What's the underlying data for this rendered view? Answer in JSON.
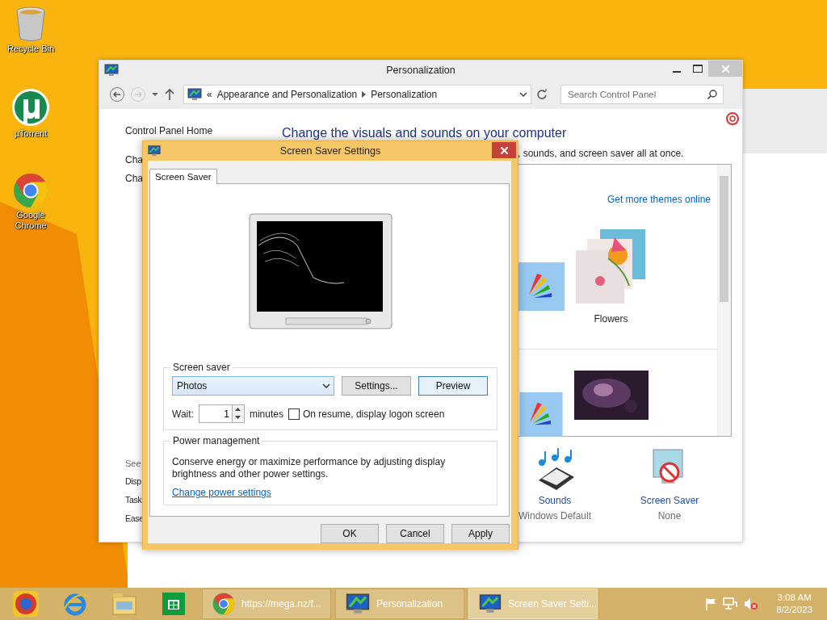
{
  "desktop_icons": [
    {
      "kind": "bin",
      "label": "Recycle Bin"
    },
    {
      "kind": "torrent",
      "label": "µTorrent"
    },
    {
      "kind": "chrome",
      "label": "Google Chrome"
    }
  ],
  "personalization": {
    "title": "Personalization",
    "breadcrumb": [
      "«",
      "Appearance and Personalization",
      "Personalization"
    ],
    "search": {
      "placeholder": "Search Control Panel"
    },
    "sidebar_links": [
      "Control Panel Home",
      "Cha",
      "Cha"
    ],
    "see_also": "See",
    "see_also_links": [
      "Disp",
      "Task",
      "Ease"
    ],
    "heading": "Change the visuals and sounds on your computer",
    "intro": ", sounds, and screen saver all at once.",
    "themes_link": "Get more themes online",
    "themes": [
      {
        "kind": "flowers",
        "name": "Flowers"
      },
      {
        "kind": "dark"
      }
    ],
    "bottom_items": [
      {
        "kind": "sounds",
        "title": "Sounds",
        "value": "Windows Default"
      },
      {
        "kind": "screensaver",
        "title": "Screen Saver",
        "value": "None"
      }
    ]
  },
  "dialog": {
    "title": "Screen Saver Settings",
    "tabs": [
      {
        "label": "Screen Saver",
        "selected": true
      }
    ],
    "screen_saver_group": "Screen saver",
    "dropdown": {
      "value": "Photos"
    },
    "settings_button": "Settings...",
    "preview_button": "Preview",
    "wait_label": "Wait:",
    "wait": {
      "value": "1"
    },
    "minutes": "minutes",
    "logon_checkbox": {
      "label": "On resume, display logon screen",
      "checked": false
    },
    "power_group": "Power management",
    "power_text": "Conserve energy or maximize performance by adjusting display brightness and other power settings.",
    "power_link": "Change power settings",
    "buttons": [
      "OK",
      "Cancel",
      "Apply"
    ]
  },
  "taskbar": {
    "tasks": [
      {
        "kind": "browser",
        "label": "https://mega.nz/f...",
        "selected": false
      },
      {
        "kind": "panel",
        "label": "Personalization",
        "selected": false
      },
      {
        "kind": "panel",
        "label": "Screen Saver Setti...",
        "selected": true
      }
    ],
    "time": "3:08 AM",
    "date": "8/2/2023"
  }
}
